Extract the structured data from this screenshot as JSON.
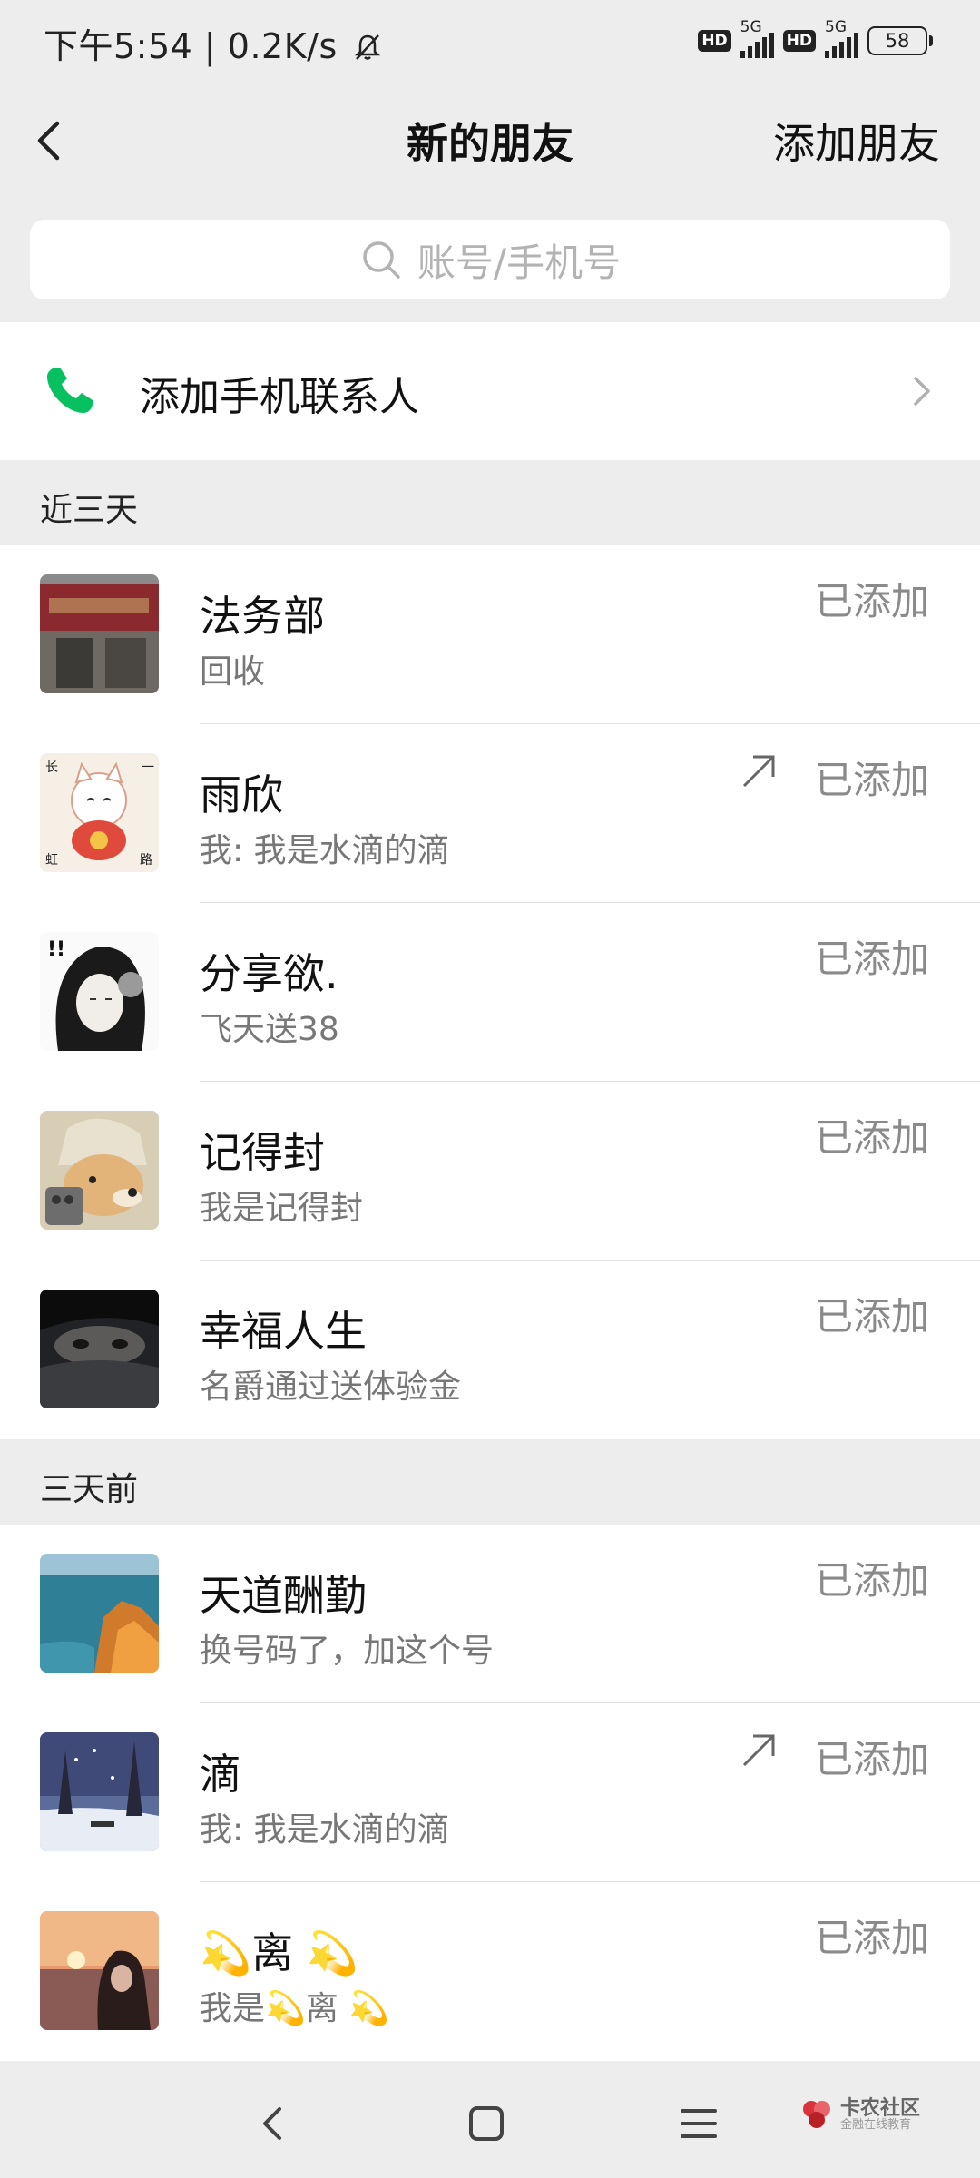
{
  "status_bar": {
    "left_text": "下午5:54 | 0.2K/s",
    "hd1": "HD",
    "net1": "5G",
    "hd2": "HD",
    "net2": "5G",
    "battery": "58"
  },
  "nav": {
    "title": "新的朋友",
    "add_friend_label": "添加朋友"
  },
  "search": {
    "placeholder": "账号/手机号"
  },
  "add_phone_contacts": {
    "label": "添加手机联系人"
  },
  "sections": [
    {
      "header": "近三天",
      "friends": [
        {
          "name": "法务部",
          "message": "回收",
          "status": "已添加",
          "shared": false
        },
        {
          "name": "雨欣",
          "message": "我: 我是水滴的滴",
          "status": "已添加",
          "shared": true
        },
        {
          "name": "分享欲.",
          "message": "飞天送38",
          "status": "已添加",
          "shared": false
        },
        {
          "name": "记得封",
          "message": "我是记得封",
          "status": "已添加",
          "shared": false
        },
        {
          "name": "幸福人生",
          "message": "名爵通过送体验金",
          "status": "已添加",
          "shared": false
        }
      ]
    },
    {
      "header": "三天前",
      "friends": [
        {
          "name": "天道酬勤",
          "message": "换号码了，加这个号",
          "status": "已添加",
          "shared": false
        },
        {
          "name": "滴",
          "message": "我: 我是水滴的滴",
          "status": "已添加",
          "shared": true
        },
        {
          "name": "💫离 💫",
          "message": "我是💫离 💫",
          "status": "已添加",
          "shared": false
        }
      ]
    }
  ],
  "watermark": {
    "title": "卡农社区",
    "subtitle": "金融在线教育"
  },
  "colors": {
    "background": "#ededed",
    "accent_green": "#07c160",
    "status_gray": "#8a8a8a"
  }
}
